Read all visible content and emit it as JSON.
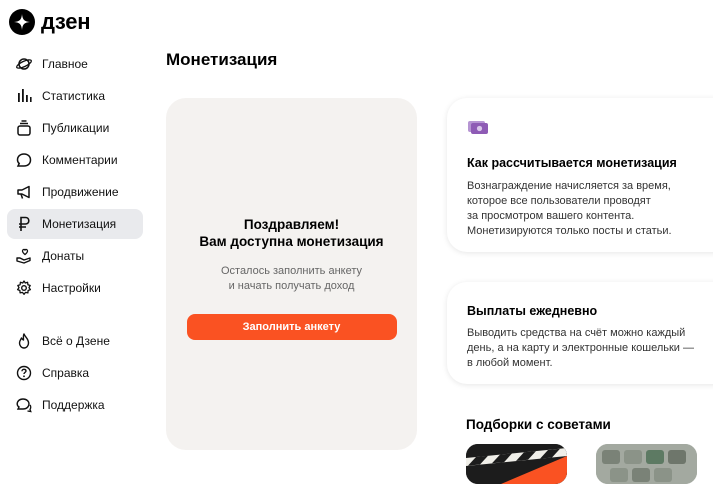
{
  "app": {
    "logo_text": "дзен"
  },
  "sidebar": {
    "items": [
      {
        "label": "Главное",
        "icon": "planet-icon"
      },
      {
        "label": "Статистика",
        "icon": "bar-chart-icon"
      },
      {
        "label": "Публикации",
        "icon": "publications-icon"
      },
      {
        "label": "Комментарии",
        "icon": "comment-icon"
      },
      {
        "label": "Продвижение",
        "icon": "megaphone-icon"
      },
      {
        "label": "Монетизация",
        "icon": "ruble-icon",
        "active": true
      },
      {
        "label": "Донаты",
        "icon": "donate-icon"
      },
      {
        "label": "Настройки",
        "icon": "gear-icon"
      }
    ],
    "secondary_items": [
      {
        "label": "Всё о Дзене",
        "icon": "flame-icon"
      },
      {
        "label": "Справка",
        "icon": "help-icon"
      },
      {
        "label": "Поддержка",
        "icon": "support-icon"
      }
    ]
  },
  "main": {
    "title": "Монетизация",
    "promo": {
      "title_line1": "Поздравляем!",
      "title_line2": "Вам доступна монетизация",
      "sub_line1": "Осталось заполнить анкету",
      "sub_line2": "и начать получать доход",
      "button_label": "Заполнить анкету",
      "button_color": "#fa5222"
    },
    "info_cards": [
      {
        "icon": "money-icon",
        "title": "Как рассчитывается монетизация",
        "lines": [
          "Вознаграждение начисляется за время,",
          "которое все пользователи проводят",
          "за просмотром вашего контента.",
          "Монетизируются только посты и статьи."
        ]
      },
      {
        "title": "Выплаты ежедневно",
        "lines": [
          "Выводить средства на счёт можно каждый",
          "день, а на карту и электронные кошельки —",
          "в любой момент."
        ]
      }
    ],
    "tips_title": "Подборки с советами"
  },
  "colors": {
    "accent": "#fa5222",
    "active_bg": "#e9eaed",
    "promo_bg": "#f4f2f0",
    "money_icon": "#8e5bb5"
  }
}
